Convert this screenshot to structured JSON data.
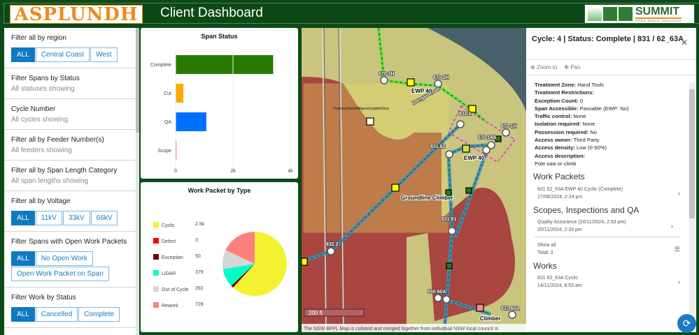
{
  "header": {
    "logo_left": "ASPLUNDH",
    "title": "Client Dashboard",
    "logo_right": "SUMMIT",
    "logo_right_sub": "OPEN SPACE SERVICES"
  },
  "filters": [
    {
      "title": "Filter all by region",
      "buttons": [
        "ALL",
        "Central Coast",
        "West"
      ]
    },
    {
      "title": "Filter Spans by Status",
      "sub": "All statuses showing"
    },
    {
      "title": "Cycle Number",
      "sub": "All cycles showing"
    },
    {
      "title": "Filter all by Feeder Number(s)",
      "sub": "All feeders showing"
    },
    {
      "title": "Filter all by Span Length Category",
      "sub": "All span lengths showing"
    },
    {
      "title": "Filter all by Voltage",
      "buttons": [
        "ALL",
        "11kV",
        "33kV",
        "66kV"
      ]
    },
    {
      "title": "Filter Spans with Open Work Packets",
      "buttons": [
        "ALL",
        "No Open Work",
        "Open Work Packet on Span"
      ]
    },
    {
      "title": "Filter Work by Status",
      "buttons": [
        "ALL",
        "Cancelled",
        "Complete"
      ]
    }
  ],
  "chart_data": [
    {
      "type": "bar",
      "title": "Span Status",
      "categories": [
        "Complete",
        "Cut",
        "QA",
        "Scope"
      ],
      "values": [
        3400,
        270,
        1070,
        30
      ],
      "colors": [
        "#277a00",
        "#ffaa00",
        "#0070ff",
        "#e040d0"
      ],
      "xlim": [
        0,
        4000
      ],
      "xticks": [
        "0",
        "2k",
        "4k"
      ],
      "orientation": "horizontal"
    },
    {
      "type": "pie",
      "title": "Work Packet by Type",
      "categories": [
        "Cyclic",
        "Defect",
        "Exception",
        "LiDAR",
        "Out of Cycle",
        "Rework"
      ],
      "values": [
        2500,
        3,
        50,
        379,
        392,
        728
      ],
      "value_labels": [
        "2.5k",
        "3",
        "50",
        "379",
        "392",
        "728"
      ],
      "colors": [
        "#f2f230",
        "#ff0000",
        "#730000",
        "#00ffc5",
        "#d6d6d6",
        "#ff7f7f"
      ]
    }
  ],
  "map": {
    "labels": [
      "670 3H",
      "670 2H",
      "EWP 40",
      "Dangar Road",
      "832 1",
      "670 1H",
      "670 14A",
      "831 62",
      "EWP 40",
      "Groundline Climber",
      "831 61",
      "832 2",
      "650 60A",
      "Climber",
      "831 60A"
    ],
    "place_label": "Hawkesbury River Rail Bridge and Long Island Group",
    "scale": "200 ft",
    "attribution": "The NSW BFPL Map is collated and merged together from individual NSW local council m"
  },
  "popup": {
    "title": "Cycle: 4 | Status: Complete | 831 / 62_63A",
    "zoom_to": "Zoom to",
    "pan": "Pan",
    "fields": [
      {
        "k": "Treatment Zone:",
        "v": "Hand Tools"
      },
      {
        "k": "Treatment Restrictions:",
        "v": ""
      },
      {
        "k": "Exception Count:",
        "v": "0"
      },
      {
        "k": "Span Accessible:",
        "v": "Passable (EWP: No)"
      },
      {
        "k": "Traffic control:",
        "v": "None"
      },
      {
        "k": "Isolation required:",
        "v": "None"
      },
      {
        "k": "Possession required:",
        "v": "No"
      },
      {
        "k": "Access owner:",
        "v": "Third Party"
      },
      {
        "k": "Access density:",
        "v": "Low (0-50%)"
      },
      {
        "k": "Access description:",
        "v": ""
      }
    ],
    "access_desc": "Pole saw or climb",
    "work_packets_title": "Work Packets",
    "work_packets": [
      {
        "name": "831 62_63A EWP 40 Cyclic (Complete)",
        "date": "27/08/2024, 2:24 pm"
      }
    ],
    "scopes_title": "Scopes, Inspections and QA",
    "scopes": [
      {
        "name": "Quality Assurance (20/11/2024, 2:33 pm)",
        "date": "20/11/2024, 2:33 pm"
      }
    ],
    "show_all": "Show all",
    "total": "Total: 3",
    "works_title": "Works",
    "works": [
      {
        "name": "831 62_63A Cyclic",
        "date": "14/11/2024, 8:53 am"
      }
    ]
  }
}
